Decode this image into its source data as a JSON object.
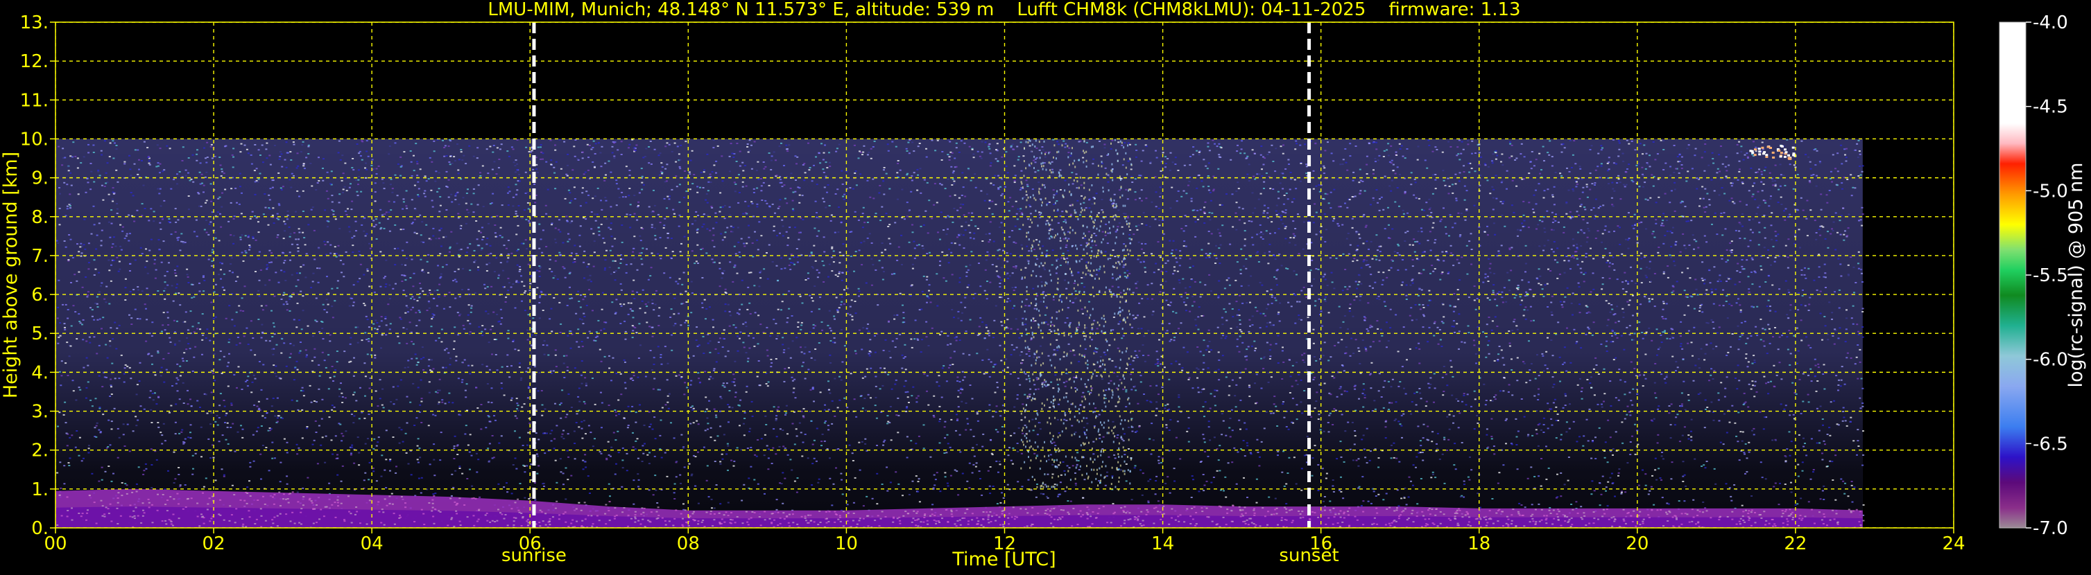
{
  "chart_data": {
    "type": "heatmap",
    "title": "LMU-MIM, Munich; 48.148° N 11.573° E, altitude: 539 m    Lufft CHM8k (CHM8kLMU): 04-11-2025    firmware: 1.13",
    "xlabel": "Time [UTC]",
    "ylabel": "Height above ground [km]",
    "xlim": [
      0,
      24
    ],
    "ylim": [
      0,
      13
    ],
    "x_ticks": [
      "00",
      "02",
      "04",
      "06",
      "08",
      "10",
      "12",
      "14",
      "16",
      "18",
      "20",
      "22",
      "24"
    ],
    "y_ticks": [
      "0.",
      "1.",
      "2.",
      "3.",
      "4.",
      "5.",
      "6.",
      "7.",
      "8.",
      "9.",
      "10.",
      "11.",
      "12.",
      "13."
    ],
    "grid": true,
    "data_extent": {
      "time_end_hours": 22.85,
      "height_max_km": 10.0
    },
    "events": [
      {
        "label": "sunrise",
        "time_hours": 6.05
      },
      {
        "label": "sunset",
        "time_hours": 15.85
      }
    ],
    "boundary_layer_km": [
      {
        "t": 0,
        "h": 0.95
      },
      {
        "t": 1,
        "h": 1.0
      },
      {
        "t": 2,
        "h": 0.95
      },
      {
        "t": 3,
        "h": 0.9
      },
      {
        "t": 4,
        "h": 0.85
      },
      {
        "t": 5,
        "h": 0.8
      },
      {
        "t": 6,
        "h": 0.7
      },
      {
        "t": 7,
        "h": 0.55
      },
      {
        "t": 8,
        "h": 0.45
      },
      {
        "t": 9,
        "h": 0.45
      },
      {
        "t": 10,
        "h": 0.45
      },
      {
        "t": 11,
        "h": 0.5
      },
      {
        "t": 12,
        "h": 0.55
      },
      {
        "t": 13,
        "h": 0.6
      },
      {
        "t": 14,
        "h": 0.6
      },
      {
        "t": 15,
        "h": 0.55
      },
      {
        "t": 16,
        "h": 0.55
      },
      {
        "t": 17,
        "h": 0.55
      },
      {
        "t": 18,
        "h": 0.5
      },
      {
        "t": 19,
        "h": 0.5
      },
      {
        "t": 20,
        "h": 0.5
      },
      {
        "t": 21,
        "h": 0.5
      },
      {
        "t": 22,
        "h": 0.5
      },
      {
        "t": 22.85,
        "h": 0.45
      }
    ],
    "colorbar": {
      "label": "log(rc-signal) @ 905 nm",
      "range": [
        -7.0,
        -4.0
      ],
      "ticks": [
        "-4.0",
        "-4.5",
        "-5.0",
        "-5.5",
        "-6.0",
        "-6.5",
        "-7.0"
      ]
    },
    "colors": {
      "background": "#000000",
      "text": "#ffff00",
      "grid": "#ffff00",
      "event_line": "#ffffff",
      "noise": "#5a5ab4",
      "boundary_layer": "#9b2fbf"
    }
  }
}
